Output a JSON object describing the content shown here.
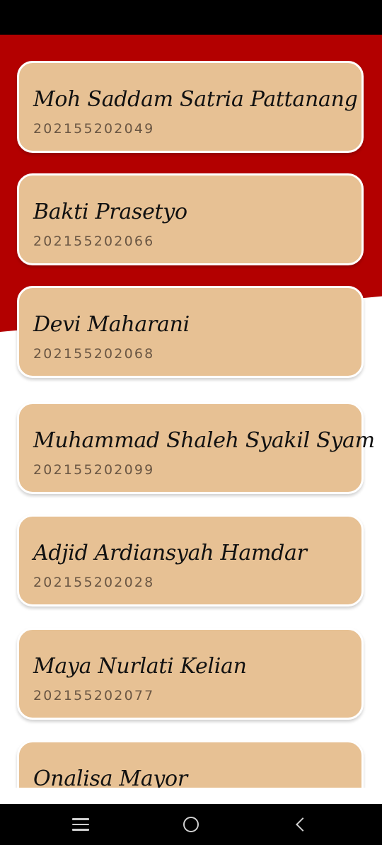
{
  "students": [
    {
      "name": "Moh Saddam Satria Pattanang",
      "nim": "202155202049"
    },
    {
      "name": "Bakti Prasetyo",
      "nim": "202155202066"
    },
    {
      "name": "Devi Maharani",
      "nim": "202155202068"
    },
    {
      "name": "Muhammad Shaleh Syakil Syam",
      "nim": "202155202099"
    },
    {
      "name": "Adjid Ardiansyah Hamdar",
      "nim": "202155202028"
    },
    {
      "name": "Maya Nurlati Kelian",
      "nim": "202155202077"
    },
    {
      "name": "Onalisa Mayor",
      "nim": ""
    }
  ],
  "colors": {
    "header_red": "#b30000",
    "card_bg": "#e7c194",
    "card_border": "#ffffff"
  },
  "nav": {
    "menu_icon": "menu-icon",
    "home_icon": "home-icon",
    "back_icon": "back-icon"
  }
}
